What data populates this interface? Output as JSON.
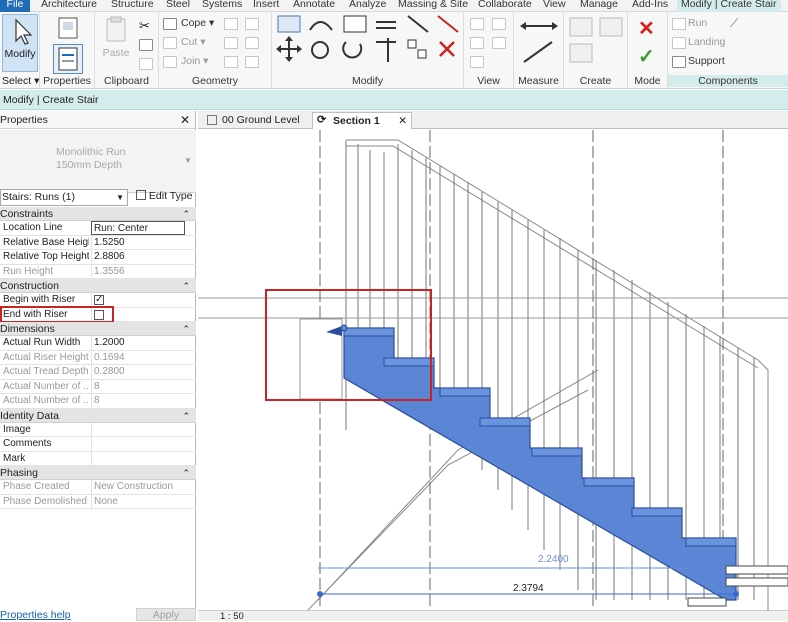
{
  "ribbon_tabs": [
    "File",
    "Architecture",
    "Structure",
    "Steel",
    "Systems",
    "Insert",
    "Annotate",
    "Analyze",
    "Massing & Site",
    "Collaborate",
    "View",
    "Manage",
    "Add-Ins",
    "Modify | Create Stair"
  ],
  "ribbon": {
    "modify_label": "Modify",
    "select_label": "Select",
    "properties_label": "Properties",
    "clipboard": {
      "paste": "Paste",
      "label": "Clipboard"
    },
    "geometry": {
      "cope": "Cope",
      "cut": "Cut",
      "join": "Join",
      "label": "Geometry"
    },
    "modify_group_label": "Modify",
    "view_label": "View",
    "measure_label": "Measure",
    "create_label": "Create",
    "mode_label": "Mode",
    "components": {
      "run": "Run",
      "landing": "Landing",
      "support": "Support",
      "label": "Components"
    }
  },
  "context_bar": "Modify | Create Stair",
  "properties": {
    "title": "Properties",
    "type_name": "Monolithic Run",
    "type_sub": "150mm Depth",
    "filter": "Stairs: Runs (1)",
    "edit_type": "Edit Type",
    "sections": [
      {
        "name": "Constraints",
        "rows": [
          {
            "name": "Location Line",
            "value": "Run: Center",
            "state": "boxed"
          },
          {
            "name": "Relative Base Height",
            "value": "1.5250",
            "state": "normal"
          },
          {
            "name": "Relative Top Height",
            "value": "2.8806",
            "state": "normal"
          },
          {
            "name": "Run Height",
            "value": "1.3556",
            "state": "grey"
          }
        ]
      },
      {
        "name": "Construction",
        "rows": [
          {
            "name": "Begin with Riser",
            "value": "checked",
            "state": "check"
          },
          {
            "name": "End with Riser",
            "value": "unchecked",
            "state": "check"
          }
        ]
      },
      {
        "name": "Dimensions",
        "rows": [
          {
            "name": "Actual Run Width",
            "value": "1.2000",
            "state": "normal"
          },
          {
            "name": "Actual Riser Height",
            "value": "0.1694",
            "state": "grey"
          },
          {
            "name": "Actual Tread Depth",
            "value": "0.2800",
            "state": "grey"
          },
          {
            "name": "Actual Number of ...",
            "value": "8",
            "state": "grey"
          },
          {
            "name": "Actual Number of ...",
            "value": "8",
            "state": "grey"
          }
        ]
      },
      {
        "name": "Identity Data",
        "rows": [
          {
            "name": "Image",
            "value": "",
            "state": "normal"
          },
          {
            "name": "Comments",
            "value": "",
            "state": "normal"
          },
          {
            "name": "Mark",
            "value": "",
            "state": "normal"
          }
        ]
      },
      {
        "name": "Phasing",
        "rows": [
          {
            "name": "Phase Created",
            "value": "New Construction",
            "state": "grey"
          },
          {
            "name": "Phase Demolished",
            "value": "None",
            "state": "grey"
          }
        ]
      }
    ],
    "help_link": "Properties help",
    "apply": "Apply"
  },
  "view_tabs": [
    {
      "label": "00 Ground Level",
      "active": false
    },
    {
      "label": "Section 1",
      "active": true
    }
  ],
  "dimensions": {
    "upper": "2.2400",
    "lower": "2.3794"
  },
  "status": {
    "scale": "1 : 50"
  },
  "colors": {
    "stair_fill": "#5b86d6",
    "highlight": "#cc2222",
    "accent": "#1f6bb8"
  }
}
